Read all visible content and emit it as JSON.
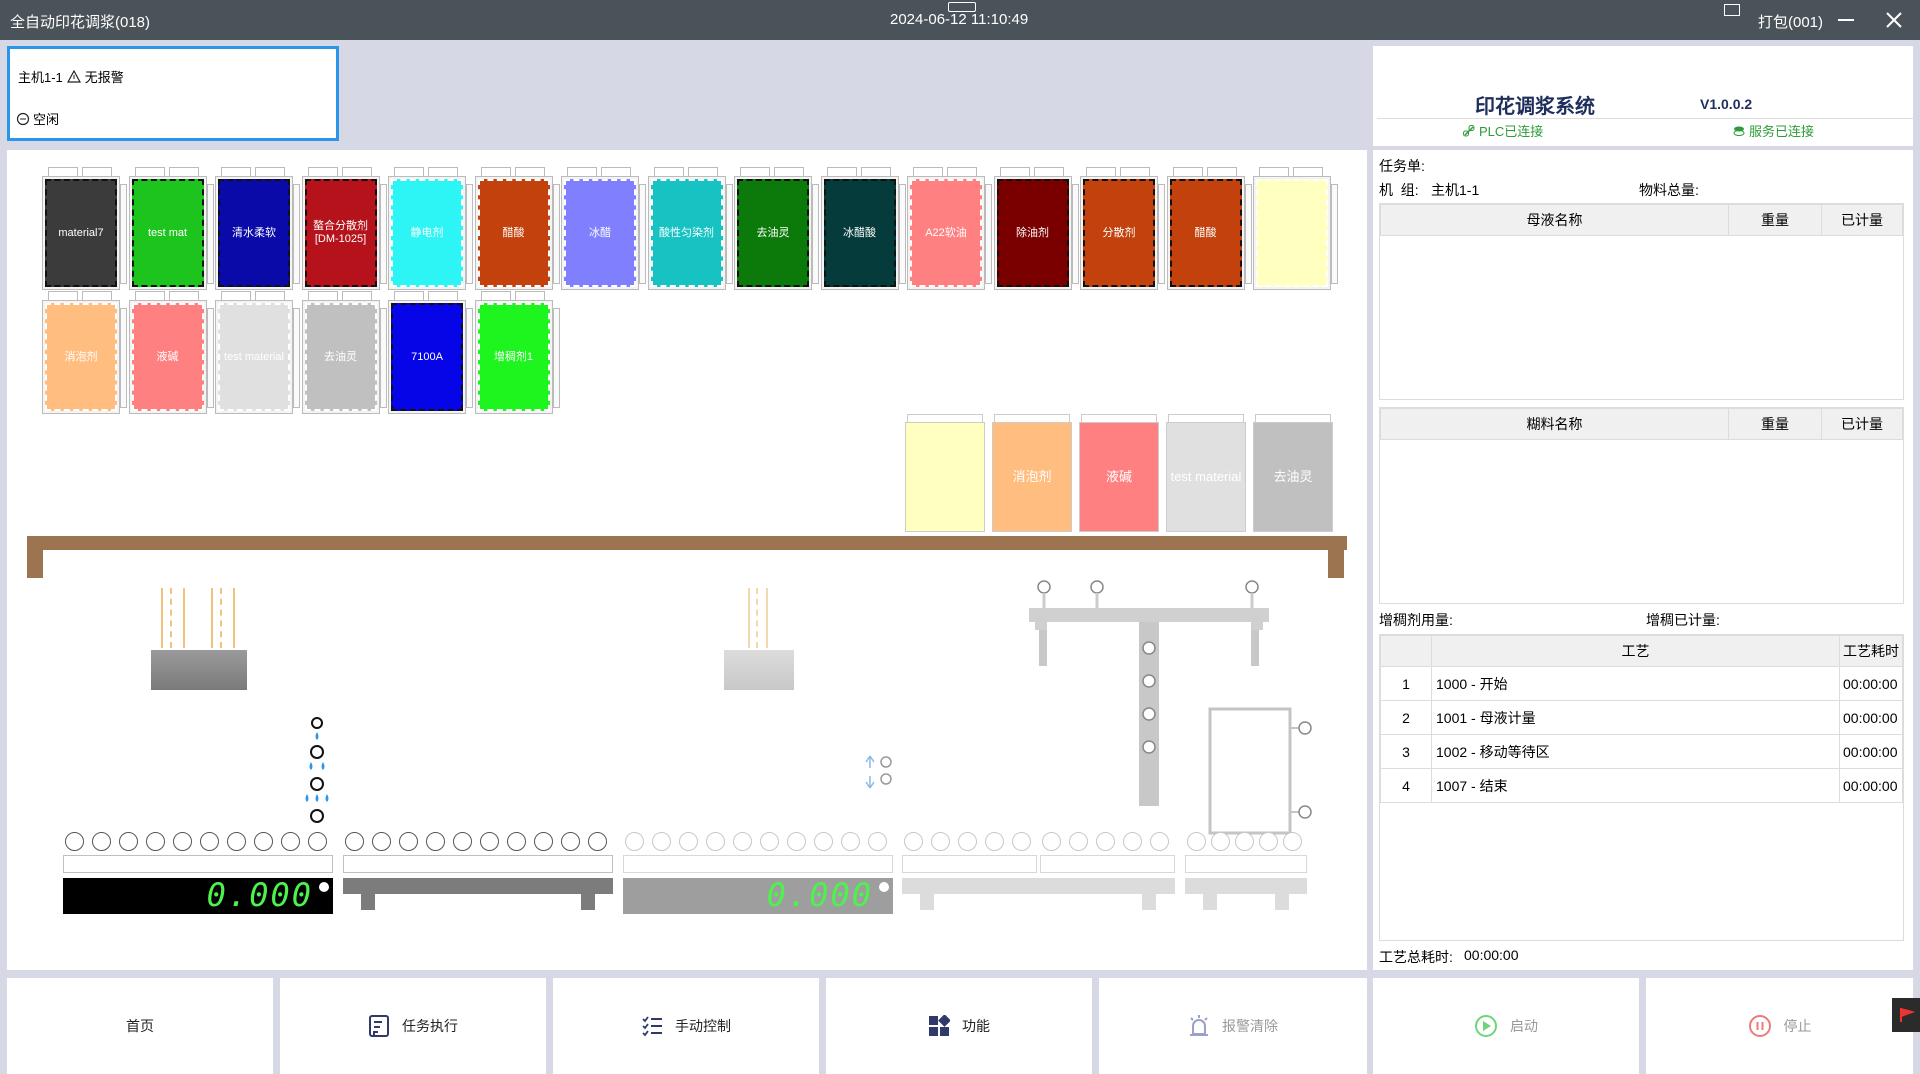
{
  "titlebar": {
    "app_title": "全自动印花调浆(018)",
    "datetime": "2024-06-12 11:10:49",
    "user": "打包(001)"
  },
  "status_panel": {
    "machine": "主机1-1",
    "alarm": "无报警",
    "state": "空闲"
  },
  "system": {
    "name": "印花调浆系统",
    "version": "V1.0.0.2",
    "plc_status": "PLC已连接",
    "service_status": "服务已连接",
    "colors": {
      "connected": "#2e9c3a",
      "accent": "#2b95e9",
      "title": "#1f2f5c"
    }
  },
  "bins_row1": [
    {
      "label": "material7",
      "color": "#3b3b3b",
      "dark": true
    },
    {
      "label": "test mat",
      "color": "#1ec41e",
      "dark": true
    },
    {
      "label": "清水柔软",
      "color": "#0a0aa8",
      "dark": true
    },
    {
      "label": "螯合分散剂[DM-1025]",
      "color": "#b5121b",
      "dark": true
    },
    {
      "label": "静电剂",
      "color": "#2ef5f5",
      "dark": false
    },
    {
      "label": "醋酸",
      "color": "#c2410c",
      "dark": false
    },
    {
      "label": "冰醋",
      "color": "#8080ff",
      "dark": false
    },
    {
      "label": "酸性匀染剂",
      "color": "#17c2c2",
      "dark": false
    },
    {
      "label": "去油灵",
      "color": "#0b7a0b",
      "dark": true
    },
    {
      "label": "冰醋酸",
      "color": "#053b3b",
      "dark": true
    },
    {
      "label": "A22软油",
      "color": "#ff8080",
      "dark": false
    },
    {
      "label": "除油剂",
      "color": "#7a0000",
      "dark": true
    },
    {
      "label": "分散剂",
      "color": "#c2410c",
      "dark": true
    },
    {
      "label": "醋酸",
      "color": "#c2410c",
      "dark": true
    },
    {
      "label": "",
      "color": "#ffffc0",
      "dark": false
    }
  ],
  "bins_row2": [
    {
      "label": "消泡剂",
      "color": "#ffbd7f",
      "dark": false
    },
    {
      "label": "液碱",
      "color": "#ff8080",
      "dark": false
    },
    {
      "label": "test material",
      "color": "#e0e0e0",
      "dark": false
    },
    {
      "label": "去油灵",
      "color": "#c0c0c0",
      "dark": false
    },
    {
      "label": "7100A",
      "color": "#0505e8",
      "dark": true
    },
    {
      "label": "增稠剂1",
      "color": "#1ef51e",
      "dark": false
    }
  ],
  "paste_bins": [
    {
      "label": "",
      "color": "#ffffc0"
    },
    {
      "label": "消泡剂",
      "color": "#ffbd7f"
    },
    {
      "label": "液碱",
      "color": "#ff8080"
    },
    {
      "label": "test material",
      "color": "#e0e0e0"
    },
    {
      "label": "去油灵",
      "color": "#c0c0c0"
    }
  ],
  "scales": [
    {
      "reading": "0.000"
    },
    {
      "reading": "0.000"
    }
  ],
  "task": {
    "title": "任务单:",
    "machine_label": "机  组:",
    "machine_value": "主机1-1",
    "material_total_label": "物料总量:",
    "mother_table": {
      "headers": [
        "母液名称",
        "重量",
        "已计量"
      ]
    },
    "paste_table": {
      "headers": [
        "糊料名称",
        "重量",
        "已计量"
      ]
    },
    "thickener_label": "增稠剂用量:",
    "thickener_measured_label": "增稠已计量:",
    "process_table": {
      "headers": [
        "",
        "工艺",
        "工艺耗时"
      ],
      "rows": [
        {
          "no": "1",
          "step": "1000 - 开始",
          "time": "00:00:00"
        },
        {
          "no": "2",
          "step": "1001 - 母液计量",
          "time": "00:00:00"
        },
        {
          "no": "3",
          "step": "1002 - 移动等待区",
          "time": "00:00:00"
        },
        {
          "no": "4",
          "step": "1007 - 结束",
          "time": "00:00:00"
        }
      ]
    },
    "total_time_label": "工艺总耗时:",
    "total_time_value": "00:00:00"
  },
  "buttons": [
    {
      "label": "首页",
      "icon": "home-icon",
      "enabled": true
    },
    {
      "label": "任务执行",
      "icon": "task-list-icon",
      "enabled": true
    },
    {
      "label": "手动控制",
      "icon": "manual-list-icon",
      "enabled": true
    },
    {
      "label": "功能",
      "icon": "grid-icon",
      "enabled": true
    },
    {
      "label": "报警清除",
      "icon": "alarm-icon",
      "enabled": false
    },
    {
      "label": "启动",
      "icon": "play-icon",
      "enabled": false
    },
    {
      "label": "停止",
      "icon": "pause-icon",
      "enabled": false
    }
  ]
}
